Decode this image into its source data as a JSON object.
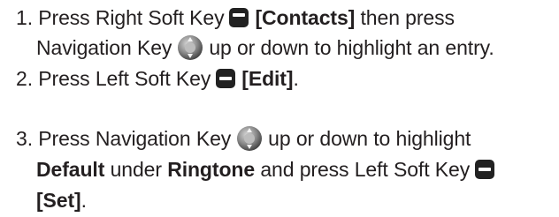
{
  "steps": [
    {
      "number": "1.",
      "line1": {
        "t1": "Press Right Soft Key",
        "b1": "[Contacts]",
        "t2": "then press"
      },
      "line2": {
        "t1": "Navigation Key",
        "t2": "up or down to highlight an entry."
      }
    },
    {
      "number": "2.",
      "line1": {
        "t1": "Press Left Soft Key",
        "b1": "[Edit]",
        "t2": "."
      }
    },
    {
      "number": "3.",
      "line1": {
        "t1": "Press Navigation Key",
        "t2": "up or down to highlight"
      },
      "line2": {
        "b1": "Default",
        "t1": "under",
        "b2": "Ringtone",
        "t2": "and press Left Soft Key"
      },
      "line3": {
        "b1": "[Set]",
        "t1": "."
      }
    }
  ],
  "icons": {
    "right_soft_key": "right-soft-key-icon",
    "left_soft_key": "left-soft-key-icon",
    "navigation_key": "navigation-key-icon"
  },
  "colors": {
    "text": "#231f20",
    "key": "#222222"
  }
}
